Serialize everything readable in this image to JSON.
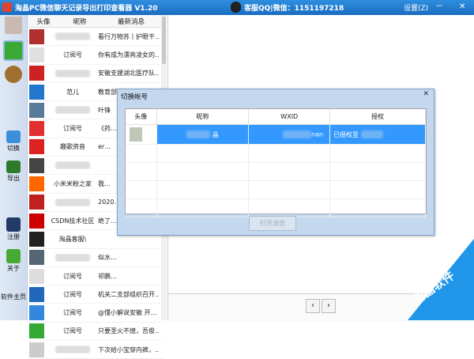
{
  "titlebar": {
    "title": "淘晶PC微信聊天记录导出打印查看器 V1.20",
    "service": "客服QQ|微信：1151197218",
    "settings": "设置(Z)",
    "minimize": "－",
    "close": "✕"
  },
  "sidebar": {
    "items": [
      {
        "label": "",
        "icon": "chat-icon"
      },
      {
        "label": "",
        "icon": "contacts-icon"
      },
      {
        "label": "切换",
        "icon": "switch-icon"
      },
      {
        "label": "导出",
        "icon": "export-icon"
      },
      {
        "label": "注册",
        "icon": "register-icon"
      },
      {
        "label": "关于",
        "icon": "about-icon"
      },
      {
        "label": "软件主页",
        "icon": ""
      }
    ]
  },
  "contacts": {
    "headers": [
      "头像",
      "昵称",
      "最新消息"
    ],
    "rows": [
      {
        "nickname": "",
        "message": "看行万物苏丨护眼干…",
        "color": "#b03030"
      },
      {
        "nickname": "订阅号",
        "message": "你有成为漂亮凌女的…",
        "color": "#e0e0e0"
      },
      {
        "nickname": "",
        "message": "安徽支援湖北医疗队…",
        "color": "#cc2222"
      },
      {
        "nickname": "范儿",
        "message": "教育部最新发布！事…",
        "color": "#2277cc"
      },
      {
        "nickname": "",
        "message": "叶锋",
        "color": "#5a7a9a"
      },
      {
        "nickname": "订阅号",
        "message": "《药…",
        "color": "#e03030"
      },
      {
        "nickname": "趣歌资音",
        "message": "er…",
        "color": "#dd2222"
      },
      {
        "nickname": "",
        "message": "",
        "color": "#444"
      },
      {
        "nickname": "小米米粉之家",
        "message": "我…",
        "color": "#ff6600"
      },
      {
        "nickname": "",
        "message": "2020…",
        "color": "#c02020"
      },
      {
        "nickname": "CSDN技术社区",
        "message": "绝了…",
        "color": "#cc0000"
      },
      {
        "nickname": "淘晶客服\\",
        "message": "",
        "color": "#222"
      },
      {
        "nickname": "",
        "message": "似水…",
        "color": "#556677"
      },
      {
        "nickname": "订阅号",
        "message": "祁鹏…",
        "color": "#dddddd"
      },
      {
        "nickname": "订阅号",
        "message": "机关二支部组织召开…",
        "color": "#2266bb"
      },
      {
        "nickname": "订阅号",
        "message": "@懂小解说安徽 开…",
        "color": "#3388dd"
      },
      {
        "nickname": "订阅号",
        "message": "只要圣火不熄，吾俊…",
        "color": "#33aa33"
      },
      {
        "nickname": "",
        "message": "下次给小宝穿内裤，…",
        "color": "#cccccc"
      }
    ]
  },
  "dialog": {
    "title": "切换帐号",
    "close": "✕",
    "headers": [
      "头像",
      "昵称",
      "WXID",
      "授权"
    ],
    "rows": [
      {
        "nickname": "晶",
        "wxid": "nan",
        "auth": "已授权至"
      }
    ],
    "ok_button": "打开浏览"
  },
  "nav": {
    "prev": "‹",
    "next": "›"
  },
  "watermark": "淘晶软件"
}
